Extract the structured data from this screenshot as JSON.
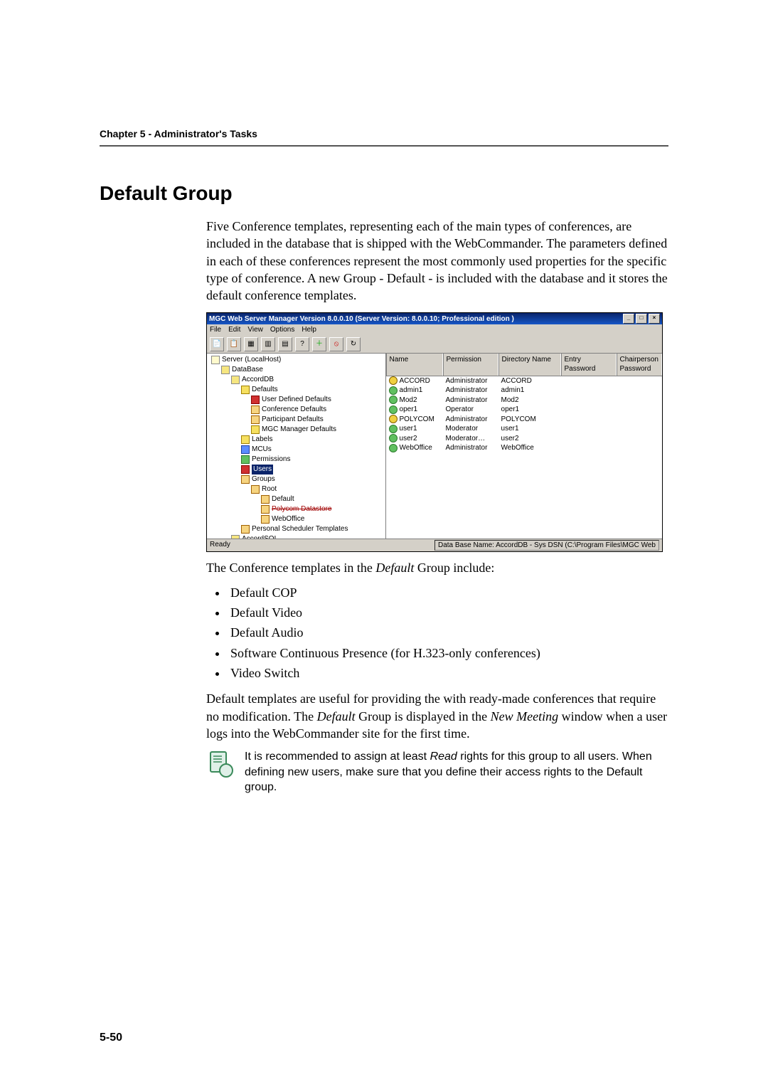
{
  "chapter_header": "Chapter 5 - Administrator's Tasks",
  "section_title": "Default Group",
  "intro_paragraph": "Five Conference templates, representing each of the main types of conferences, are included in the database that is shipped with the WebCommander. The parameters defined in each of these conferences represent the most commonly used properties for the specific type of conference. A new Group - Default - is included with the database and it stores the default conference templates.",
  "app": {
    "title": "MGC Web Server Manager Version 8.0.0.10  (Server Version: 8.0.0.10;  Professional edition )",
    "menu": [
      "File",
      "Edit",
      "View",
      "Options",
      "Help"
    ],
    "window_buttons": [
      "_",
      "□",
      "×"
    ],
    "columns": {
      "name": "Name",
      "permission": "Permission",
      "directory": "Directory Name",
      "entry": "Entry Password",
      "chair": "Chairperson Password"
    },
    "rows": [
      {
        "name": "ACCORD",
        "permission": "Administrator",
        "directory": "ACCORD",
        "icon": "ic-yellow"
      },
      {
        "name": "admin1",
        "permission": "Administrator",
        "directory": "admin1",
        "icon": "ic-green"
      },
      {
        "name": "Mod2",
        "permission": "Administrator",
        "directory": "Mod2",
        "icon": "ic-green"
      },
      {
        "name": "oper1",
        "permission": "Operator",
        "directory": "oper1",
        "icon": "ic-green"
      },
      {
        "name": "POLYCOM",
        "permission": "Administrator",
        "directory": "POLYCOM",
        "icon": "ic-yellow"
      },
      {
        "name": "user1",
        "permission": "Moderator",
        "directory": "user1",
        "icon": "ic-green"
      },
      {
        "name": "user2",
        "permission": "Moderator…",
        "directory": "user2",
        "icon": "ic-green"
      },
      {
        "name": "WebOffice",
        "permission": "Administrator",
        "directory": "WebOffice",
        "icon": "ic-green"
      }
    ],
    "tree": {
      "root": "Server (LocalHost)",
      "database": "DataBase",
      "accorddb": "AccordDB",
      "defaults": "Defaults",
      "user_defined_defaults": "User Defined Defaults",
      "conference_defaults": "Conference Defaults",
      "participant_defaults": "Participant Defaults",
      "mgc_manager_defaults": "MGC Manager Defaults",
      "labels": "Labels",
      "mcus": "MCUs",
      "permissions": "Permissions",
      "users": "Users",
      "groups": "Groups",
      "root_group": "Root",
      "default_group": "Default",
      "polycom_datastore": "Polycom Datastore",
      "weboffice": "WebOffice",
      "scheduler_templates": "Personal Scheduler Templates",
      "accordsql": "AccordSQL"
    },
    "status_left": "Ready",
    "status_right": "Data Base Name: AccordDB - Sys DSN (C:\\Program Files\\MGC Web"
  },
  "post_screenshot_lead": "The Conference templates in the ",
  "post_screenshot_italic": "Default",
  "post_screenshot_tail": " Group include:",
  "templates_list": [
    "Default COP",
    "Default Video",
    "Default Audio",
    "Software Continuous Presence (for H.323-only conferences)",
    "Video Switch"
  ],
  "para2_a": "Default templates are useful for providing the with ready-made conferences that require no modification. The ",
  "para2_i1": "Default",
  "para2_b": " Group is displayed in the ",
  "para2_i2": "New Meeting",
  "para2_c": " window when a user logs into the WebCommander site for the first time.",
  "note_a": "It is recommended to assign at least ",
  "note_i": "Read",
  "note_b": " rights for this group to all users. When defining new users, make sure that you define their access rights to the Default group.",
  "page_number": "5-50"
}
